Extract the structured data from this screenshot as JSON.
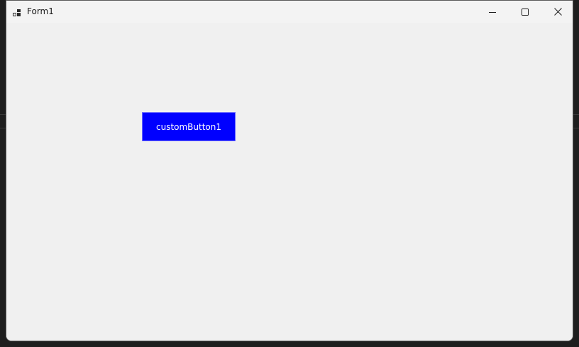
{
  "window": {
    "title": "Form1"
  },
  "titlebar": {
    "icons": {
      "app": "app-window-icon",
      "minimize": "minimize-icon",
      "maximize": "maximize-icon",
      "close": "close-icon"
    }
  },
  "client": {
    "custom_button_label": "customButton1"
  },
  "colors": {
    "client_background": "#f0f0f0",
    "titlebar_background": "#f3f3f3",
    "button_background": "#0000ff",
    "button_text": "#ffffff"
  }
}
